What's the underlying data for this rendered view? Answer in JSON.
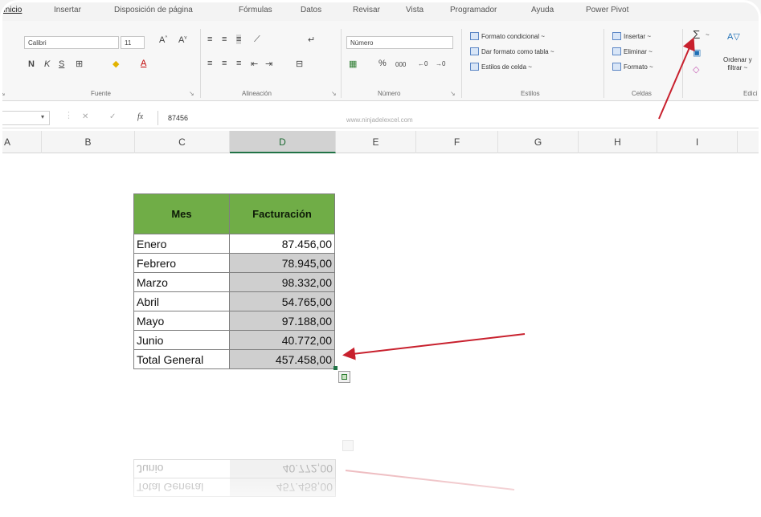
{
  "ribbon": {
    "tabs": [
      "Inicio",
      "Insertar",
      "Disposición de página",
      "Fórmulas",
      "Datos",
      "Revisar",
      "Vista",
      "Programador",
      "Ayuda",
      "Power Pivot"
    ],
    "font": {
      "name": "Calibri",
      "size": "11",
      "bold": "N",
      "italic": "K",
      "underline": "S",
      "label": "Fuente"
    },
    "alignment": {
      "label": "Alineación"
    },
    "number": {
      "format": "Número",
      "percent": "%",
      "thousands": "000",
      "label": "Número"
    },
    "styles": {
      "conditional": "Formato condicional ~",
      "as_table": "Dar formato como tabla ~",
      "cell_styles": "Estilos de celda ~",
      "label": "Estilos"
    },
    "cells": {
      "insert": "Insertar ~",
      "delete": "Eliminar ~",
      "format": "Formato ~",
      "label": "Celdas"
    },
    "editing": {
      "sort_line1": "Ordenar y",
      "sort_line2": "filtrar ~",
      "label": "Edici"
    }
  },
  "formula_bar": {
    "fx": "fx",
    "value": "87456",
    "watermark": "www.ninjadelexcel.com"
  },
  "columns": [
    "A",
    "B",
    "C",
    "D",
    "E",
    "F",
    "G",
    "H",
    "I"
  ],
  "selected_column": "D",
  "table": {
    "headers": [
      "Mes",
      "Facturación"
    ],
    "rows": [
      {
        "label": "Enero",
        "value": "87.456,00"
      },
      {
        "label": "Febrero",
        "value": "78.945,00"
      },
      {
        "label": "Marzo",
        "value": "98.332,00"
      },
      {
        "label": "Abril",
        "value": "54.765,00"
      },
      {
        "label": "Mayo",
        "value": "97.188,00"
      },
      {
        "label": "Junio",
        "value": "40.772,00"
      },
      {
        "label": "Total General",
        "value": "457.458,00"
      }
    ]
  },
  "reflection": {
    "total_label": "Total General",
    "total_value": "457.458,00",
    "june_label": "Junio",
    "june_value": "40.772,00"
  },
  "colors": {
    "header_green": "#70ad47",
    "arrow_red": "#c8202d",
    "selection_gray": "#cfcfcf"
  }
}
